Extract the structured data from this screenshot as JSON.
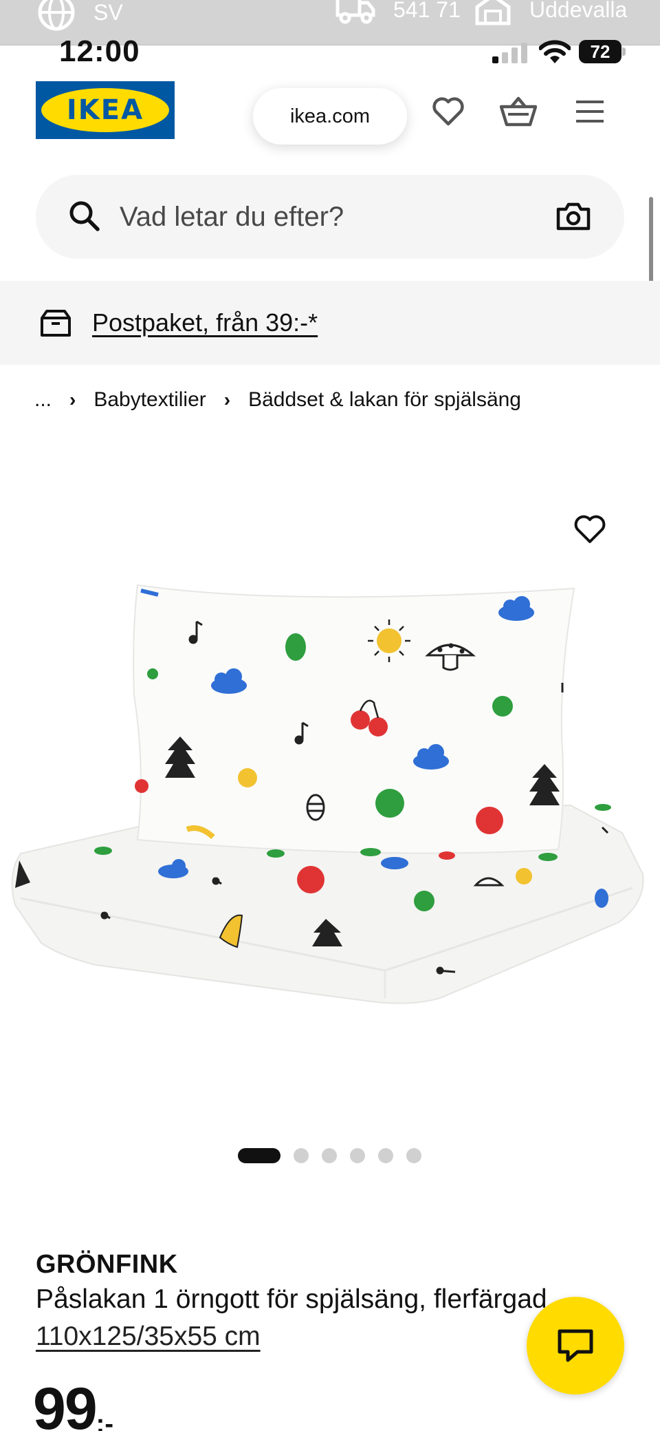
{
  "util_bar": {
    "language": "SV",
    "postcode": "541 71",
    "store": "Uddevalla",
    "icons": [
      "globe-icon",
      "truck-icon",
      "store-icon"
    ]
  },
  "status_bar": {
    "time": "12:00",
    "battery": "72",
    "icons": [
      "signal-icon",
      "wifi-icon",
      "battery-icon"
    ]
  },
  "header": {
    "logo_text": "IKEA",
    "url": "ikea.com",
    "icons": [
      "heart-icon",
      "basket-icon",
      "hamburger-menu-icon"
    ]
  },
  "search": {
    "placeholder": "Vad letar du efter?",
    "icons": [
      "search-icon",
      "camera-icon"
    ]
  },
  "delivery": {
    "link_text": "Postpaket, från 39:-*",
    "icon": "package-icon"
  },
  "breadcrumb": {
    "ellipsis": "...",
    "items": [
      "Babytextilier",
      "Bäddset & lakan för spjälsäng"
    ]
  },
  "gallery": {
    "image_count": 6,
    "active_index": 0,
    "wishlist_icon": "heart-outline-icon"
  },
  "product": {
    "brand": "GRÖNFINK",
    "description": "Påslakan 1 örngott för spjälsäng, flerfärgad",
    "size": "110x125/35x55 cm",
    "price_integer": "99",
    "price_suffix": ":-"
  },
  "chat": {
    "icon": "chat-icon"
  },
  "colors": {
    "ikea_blue": "#0058a3",
    "ikea_yellow": "#ffdb00",
    "surface_grey": "#f5f5f5"
  }
}
